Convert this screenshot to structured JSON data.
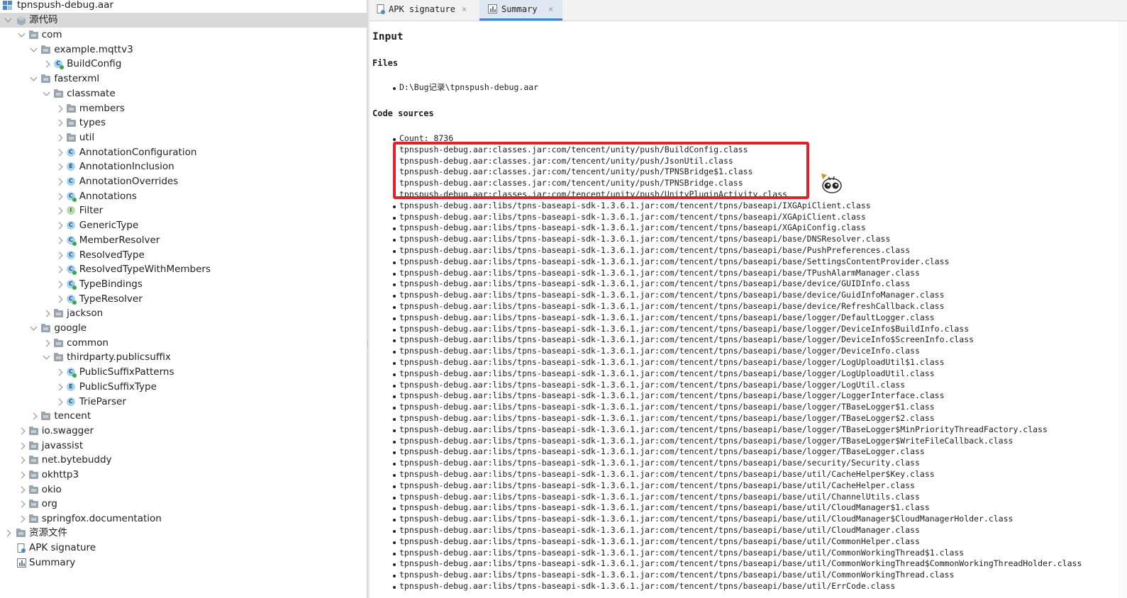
{
  "tree": {
    "root_label": "tpnspush-debug.aar",
    "source_node": "源代码",
    "items": [
      {
        "label": "com",
        "depth": 1,
        "kind": "folder",
        "state": "open"
      },
      {
        "label": "example.mqttv3",
        "depth": 2,
        "kind": "folder",
        "state": "open"
      },
      {
        "label": "BuildConfig",
        "depth": 3,
        "kind": "class",
        "badge": "C",
        "dot": true,
        "state": "closed"
      },
      {
        "label": "fasterxml",
        "depth": 2,
        "kind": "folder",
        "state": "open"
      },
      {
        "label": "classmate",
        "depth": 3,
        "kind": "folder",
        "state": "open"
      },
      {
        "label": "members",
        "depth": 4,
        "kind": "folder",
        "state": "closed"
      },
      {
        "label": "types",
        "depth": 4,
        "kind": "folder",
        "state": "closed"
      },
      {
        "label": "util",
        "depth": 4,
        "kind": "folder",
        "state": "closed"
      },
      {
        "label": "AnnotationConfiguration",
        "depth": 4,
        "kind": "class",
        "badge": "C",
        "dot": false,
        "state": "closed"
      },
      {
        "label": "AnnotationInclusion",
        "depth": 4,
        "kind": "class",
        "badge": "E",
        "dot": false,
        "state": "closed"
      },
      {
        "label": "AnnotationOverrides",
        "depth": 4,
        "kind": "class",
        "badge": "C",
        "dot": false,
        "state": "closed"
      },
      {
        "label": "Annotations",
        "depth": 4,
        "kind": "class",
        "badge": "C",
        "dot": true,
        "state": "closed"
      },
      {
        "label": "Filter",
        "depth": 4,
        "kind": "class",
        "badge": "I",
        "dot": false,
        "state": "closed"
      },
      {
        "label": "GenericType",
        "depth": 4,
        "kind": "class",
        "badge": "C",
        "dot": false,
        "state": "closed"
      },
      {
        "label": "MemberResolver",
        "depth": 4,
        "kind": "class",
        "badge": "C",
        "dot": true,
        "state": "closed"
      },
      {
        "label": "ResolvedType",
        "depth": 4,
        "kind": "class",
        "badge": "C",
        "dot": false,
        "state": "closed"
      },
      {
        "label": "ResolvedTypeWithMembers",
        "depth": 4,
        "kind": "class",
        "badge": "C",
        "dot": true,
        "state": "closed"
      },
      {
        "label": "TypeBindings",
        "depth": 4,
        "kind": "class",
        "badge": "C",
        "dot": true,
        "state": "closed"
      },
      {
        "label": "TypeResolver",
        "depth": 4,
        "kind": "class",
        "badge": "C",
        "dot": true,
        "state": "closed"
      },
      {
        "label": "jackson",
        "depth": 3,
        "kind": "folder",
        "state": "closed"
      },
      {
        "label": "google",
        "depth": 2,
        "kind": "folder",
        "state": "open"
      },
      {
        "label": "common",
        "depth": 3,
        "kind": "folder",
        "state": "closed"
      },
      {
        "label": "thirdparty.publicsuffix",
        "depth": 3,
        "kind": "folder",
        "state": "open"
      },
      {
        "label": "PublicSuffixPatterns",
        "depth": 4,
        "kind": "class",
        "badge": "C",
        "dot": true,
        "state": "closed"
      },
      {
        "label": "PublicSuffixType",
        "depth": 4,
        "kind": "class",
        "badge": "E",
        "dot": false,
        "state": "closed"
      },
      {
        "label": "TrieParser",
        "depth": 4,
        "kind": "class",
        "badge": "C",
        "dot": false,
        "state": "closed"
      },
      {
        "label": "tencent",
        "depth": 2,
        "kind": "folder",
        "state": "closed"
      },
      {
        "label": "io.swagger",
        "depth": 1,
        "kind": "folder",
        "state": "closed"
      },
      {
        "label": "javassist",
        "depth": 1,
        "kind": "folder",
        "state": "closed"
      },
      {
        "label": "net.bytebuddy",
        "depth": 1,
        "kind": "folder",
        "state": "closed"
      },
      {
        "label": "okhttp3",
        "depth": 1,
        "kind": "folder",
        "state": "closed"
      },
      {
        "label": "okio",
        "depth": 1,
        "kind": "folder",
        "state": "closed"
      },
      {
        "label": "org",
        "depth": 1,
        "kind": "folder",
        "state": "closed"
      },
      {
        "label": "springfox.documentation",
        "depth": 1,
        "kind": "folder",
        "state": "closed"
      }
    ],
    "resources_node": "资源文件",
    "apk_signature_node": "APK signature",
    "summary_node": "Summary"
  },
  "tabs": [
    {
      "label": "APK signature",
      "active": false
    },
    {
      "label": "Summary",
      "active": true
    }
  ],
  "tab_close_glyph": "×",
  "summary": {
    "heading": "Input",
    "files_heading": "Files",
    "file_path": "D:\\Bug记录\\tpnspush-debug.aar",
    "code_sources_heading": "Code sources",
    "count_line": "Count: 8736",
    "sources": [
      "tpnspush-debug.aar:classes.jar:com/tencent/unity/push/BuildConfig.class",
      "tpnspush-debug.aar:classes.jar:com/tencent/unity/push/JsonUtil.class",
      "tpnspush-debug.aar:classes.jar:com/tencent/unity/push/TPNSBridge$1.class",
      "tpnspush-debug.aar:classes.jar:com/tencent/unity/push/TPNSBridge.class",
      "tpnspush-debug.aar:classes.jar:com/tencent/unity/push/UnityPluginActivity.class",
      "tpnspush-debug.aar:libs/tpns-baseapi-sdk-1.3.6.1.jar:com/tencent/tpns/baseapi/IXGApiClient.class",
      "tpnspush-debug.aar:libs/tpns-baseapi-sdk-1.3.6.1.jar:com/tencent/tpns/baseapi/XGApiClient.class",
      "tpnspush-debug.aar:libs/tpns-baseapi-sdk-1.3.6.1.jar:com/tencent/tpns/baseapi/XGApiConfig.class",
      "tpnspush-debug.aar:libs/tpns-baseapi-sdk-1.3.6.1.jar:com/tencent/tpns/baseapi/base/DNSResolver.class",
      "tpnspush-debug.aar:libs/tpns-baseapi-sdk-1.3.6.1.jar:com/tencent/tpns/baseapi/base/PushPreferences.class",
      "tpnspush-debug.aar:libs/tpns-baseapi-sdk-1.3.6.1.jar:com/tencent/tpns/baseapi/base/SettingsContentProvider.class",
      "tpnspush-debug.aar:libs/tpns-baseapi-sdk-1.3.6.1.jar:com/tencent/tpns/baseapi/base/TPushAlarmManager.class",
      "tpnspush-debug.aar:libs/tpns-baseapi-sdk-1.3.6.1.jar:com/tencent/tpns/baseapi/base/device/GUIDInfo.class",
      "tpnspush-debug.aar:libs/tpns-baseapi-sdk-1.3.6.1.jar:com/tencent/tpns/baseapi/base/device/GuidInfoManager.class",
      "tpnspush-debug.aar:libs/tpns-baseapi-sdk-1.3.6.1.jar:com/tencent/tpns/baseapi/base/device/RefreshCallback.class",
      "tpnspush-debug.aar:libs/tpns-baseapi-sdk-1.3.6.1.jar:com/tencent/tpns/baseapi/base/logger/DefaultLogger.class",
      "tpnspush-debug.aar:libs/tpns-baseapi-sdk-1.3.6.1.jar:com/tencent/tpns/baseapi/base/logger/DeviceInfo$BuildInfo.class",
      "tpnspush-debug.aar:libs/tpns-baseapi-sdk-1.3.6.1.jar:com/tencent/tpns/baseapi/base/logger/DeviceInfo$ScreenInfo.class",
      "tpnspush-debug.aar:libs/tpns-baseapi-sdk-1.3.6.1.jar:com/tencent/tpns/baseapi/base/logger/DeviceInfo.class",
      "tpnspush-debug.aar:libs/tpns-baseapi-sdk-1.3.6.1.jar:com/tencent/tpns/baseapi/base/logger/LogUploadUtil$1.class",
      "tpnspush-debug.aar:libs/tpns-baseapi-sdk-1.3.6.1.jar:com/tencent/tpns/baseapi/base/logger/LogUploadUtil.class",
      "tpnspush-debug.aar:libs/tpns-baseapi-sdk-1.3.6.1.jar:com/tencent/tpns/baseapi/base/logger/LogUtil.class",
      "tpnspush-debug.aar:libs/tpns-baseapi-sdk-1.3.6.1.jar:com/tencent/tpns/baseapi/base/logger/LoggerInterface.class",
      "tpnspush-debug.aar:libs/tpns-baseapi-sdk-1.3.6.1.jar:com/tencent/tpns/baseapi/base/logger/TBaseLogger$1.class",
      "tpnspush-debug.aar:libs/tpns-baseapi-sdk-1.3.6.1.jar:com/tencent/tpns/baseapi/base/logger/TBaseLogger$2.class",
      "tpnspush-debug.aar:libs/tpns-baseapi-sdk-1.3.6.1.jar:com/tencent/tpns/baseapi/base/logger/TBaseLogger$MinPriorityThreadFactory.class",
      "tpnspush-debug.aar:libs/tpns-baseapi-sdk-1.3.6.1.jar:com/tencent/tpns/baseapi/base/logger/TBaseLogger$WriteFileCallback.class",
      "tpnspush-debug.aar:libs/tpns-baseapi-sdk-1.3.6.1.jar:com/tencent/tpns/baseapi/base/logger/TBaseLogger.class",
      "tpnspush-debug.aar:libs/tpns-baseapi-sdk-1.3.6.1.jar:com/tencent/tpns/baseapi/base/security/Security.class",
      "tpnspush-debug.aar:libs/tpns-baseapi-sdk-1.3.6.1.jar:com/tencent/tpns/baseapi/base/util/CacheHelper$Key.class",
      "tpnspush-debug.aar:libs/tpns-baseapi-sdk-1.3.6.1.jar:com/tencent/tpns/baseapi/base/util/CacheHelper.class",
      "tpnspush-debug.aar:libs/tpns-baseapi-sdk-1.3.6.1.jar:com/tencent/tpns/baseapi/base/util/ChannelUtils.class",
      "tpnspush-debug.aar:libs/tpns-baseapi-sdk-1.3.6.1.jar:com/tencent/tpns/baseapi/base/util/CloudManager$1.class",
      "tpnspush-debug.aar:libs/tpns-baseapi-sdk-1.3.6.1.jar:com/tencent/tpns/baseapi/base/util/CloudManager$CloudManagerHolder.class",
      "tpnspush-debug.aar:libs/tpns-baseapi-sdk-1.3.6.1.jar:com/tencent/tpns/baseapi/base/util/CloudManager.class",
      "tpnspush-debug.aar:libs/tpns-baseapi-sdk-1.3.6.1.jar:com/tencent/tpns/baseapi/base/util/CommonHelper.class",
      "tpnspush-debug.aar:libs/tpns-baseapi-sdk-1.3.6.1.jar:com/tencent/tpns/baseapi/base/util/CommonWorkingThread$1.class",
      "tpnspush-debug.aar:libs/tpns-baseapi-sdk-1.3.6.1.jar:com/tencent/tpns/baseapi/base/util/CommonWorkingThread$CommonWorkingThreadHolder.class",
      "tpnspush-debug.aar:libs/tpns-baseapi-sdk-1.3.6.1.jar:com/tencent/tpns/baseapi/base/util/CommonWorkingThread.class",
      "tpnspush-debug.aar:libs/tpns-baseapi-sdk-1.3.6.1.jar:com/tencent/tpns/baseapi/base/util/ErrCode.class"
    ],
    "highlight_color": "#e3202b"
  }
}
